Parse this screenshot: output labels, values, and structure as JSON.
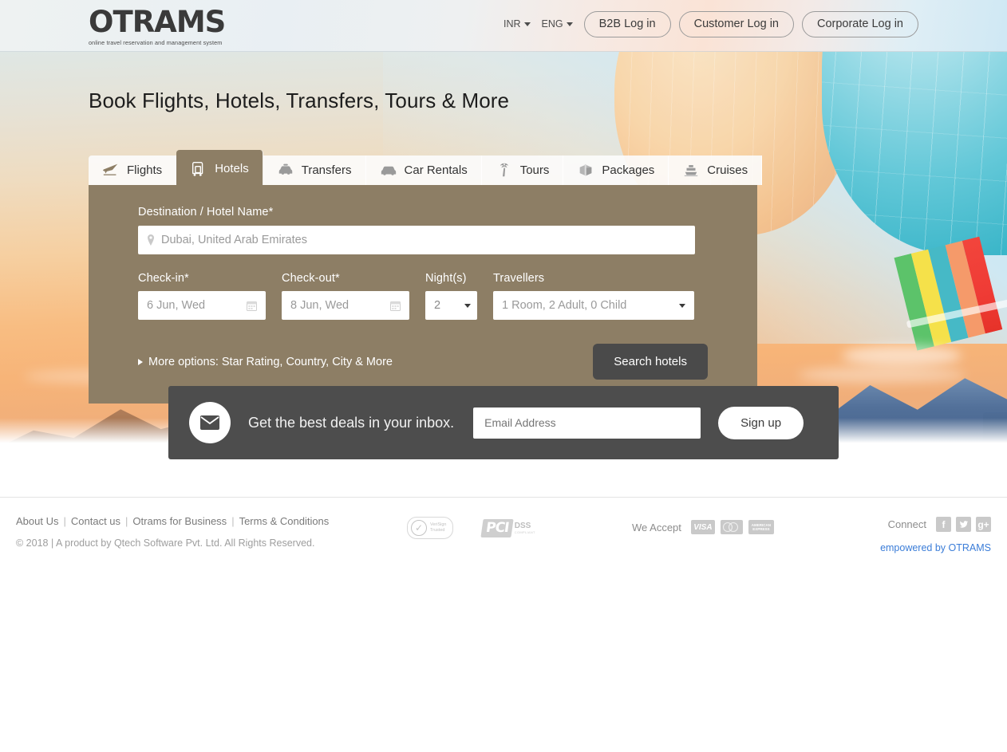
{
  "header": {
    "logo_text": "OTRAMS",
    "logo_tagline": "online travel reservation and management system",
    "currency": "INR",
    "language": "ENG",
    "buttons": [
      {
        "label": "B2B Log in"
      },
      {
        "label": "Customer Log in"
      },
      {
        "label": "Corporate Log in"
      }
    ]
  },
  "hero": {
    "title": "Book Flights, Hotels, Transfers, Tours & More"
  },
  "tabs": [
    {
      "label": "Flights",
      "icon": "airplane-icon",
      "active": false
    },
    {
      "label": "Hotels",
      "icon": "luggage-cart-icon",
      "active": true
    },
    {
      "label": "Transfers",
      "icon": "taxi-icon",
      "active": false
    },
    {
      "label": "Car Rentals",
      "icon": "car-icon",
      "active": false
    },
    {
      "label": "Tours",
      "icon": "palm-tree-icon",
      "active": false
    },
    {
      "label": "Packages",
      "icon": "box-icon",
      "active": false
    },
    {
      "label": "Cruises",
      "icon": "ship-icon",
      "active": false
    }
  ],
  "search_form": {
    "destination_label": "Destination / Hotel Name*",
    "destination_value": "Dubai, United Arab Emirates",
    "checkin_label": "Check-in*",
    "checkin_value": "6 Jun, Wed",
    "checkout_label": "Check-out*",
    "checkout_value": "8 Jun, Wed",
    "nights_label": "Night(s)",
    "nights_value": "2",
    "travellers_label": "Travellers",
    "travellers_value": "1 Room, 2 Adult, 0 Child",
    "more_options": "More options: Star Rating, Country, City & More",
    "search_button": "Search hotels",
    "panel_color": "#8d7e65",
    "button_color": "#4a4a4a"
  },
  "newsletter": {
    "headline": "Get the best deals in your inbox.",
    "email_placeholder": "Email Address",
    "email_value": "",
    "signup_label": "Sign up",
    "bar_color": "#4d4d4d"
  },
  "footer": {
    "links": [
      {
        "label": "About Us"
      },
      {
        "label": "Contact us"
      },
      {
        "label": "Otrams for Business"
      },
      {
        "label": "Terms & Conditions"
      }
    ],
    "copyright": "© 2018 | A product by Qtech Software Pvt. Ltd. All Rights Reserved.",
    "badges": [
      {
        "name": "verisign-trusted-badge",
        "line1": "VeriSign",
        "line2": "Trusted"
      },
      {
        "name": "pci-dss-badge",
        "mark": "PCI",
        "title": "DSS",
        "sub": "COMPLIANT"
      }
    ],
    "we_accept_label": "We Accept",
    "cards": [
      {
        "name": "visa-card-icon",
        "label": "VISA"
      },
      {
        "name": "mastercard-card-icon",
        "label": ""
      },
      {
        "name": "amex-card-icon",
        "label": "AMERICAN EXPRESS"
      }
    ],
    "connect_label": "Connect",
    "social": [
      {
        "name": "facebook-icon",
        "glyph": "f"
      },
      {
        "name": "twitter-icon",
        "glyph": "ᵗ"
      },
      {
        "name": "google-plus-icon",
        "glyph": "g+"
      }
    ],
    "empowered_by": "empowered by OTRAMS",
    "link_color": "#3b7dd8"
  }
}
